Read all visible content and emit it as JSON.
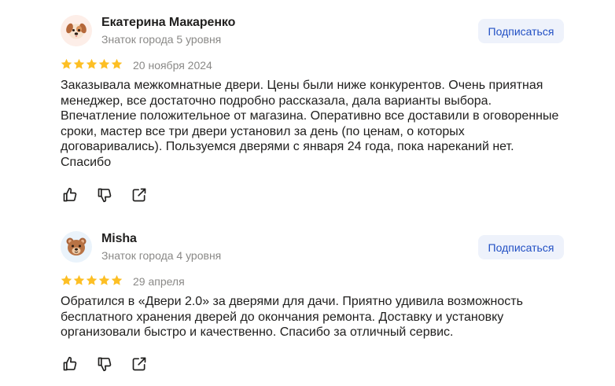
{
  "reviews": [
    {
      "author": "Екатерина Макаренко",
      "level": "Знаток города 5 уровня",
      "subscribe_label": "Подписаться",
      "avatar_icon": "puppy-emoji-avatar",
      "rating": 5,
      "date": "20 ноября 2024",
      "text_lines": [
        "Заказывала межкомнатные двери. Цены были ниже конкурентов. Очень приятная",
        "менеджер, все достаточно подробно рассказала, дала варианты выбора.",
        "Впечатление положительное от магазина. Оперативно все доставили в оговоренные",
        "сроки, мастер все три двери установил за день (по ценам, о которых",
        "договаривались). Пользуемся дверями с января 24 года, пока нареканий нет.",
        "Спасибо"
      ]
    },
    {
      "author": "Misha",
      "level": "Знаток города 4 уровня",
      "subscribe_label": "Подписаться",
      "avatar_icon": "bear-emoji-avatar",
      "rating": 5,
      "date": "29 апреля",
      "text_lines": [
        "Обратился в «Двери 2.0» за дверями для дачи. Приятно удивила возможность",
        "бесплатного хранения дверей до окончания ремонта. Доставку и установку",
        "организовали быстро и качественно. Спасибо за отличный сервис."
      ]
    }
  ],
  "colors": {
    "star": "#fdbf24",
    "subscribe_bg": "#eef2fb",
    "subscribe_text": "#2250c4",
    "secondary_text": "#8a8987"
  },
  "action_icons": [
    "thumbs-up-icon",
    "thumbs-down-icon",
    "share-icon"
  ]
}
